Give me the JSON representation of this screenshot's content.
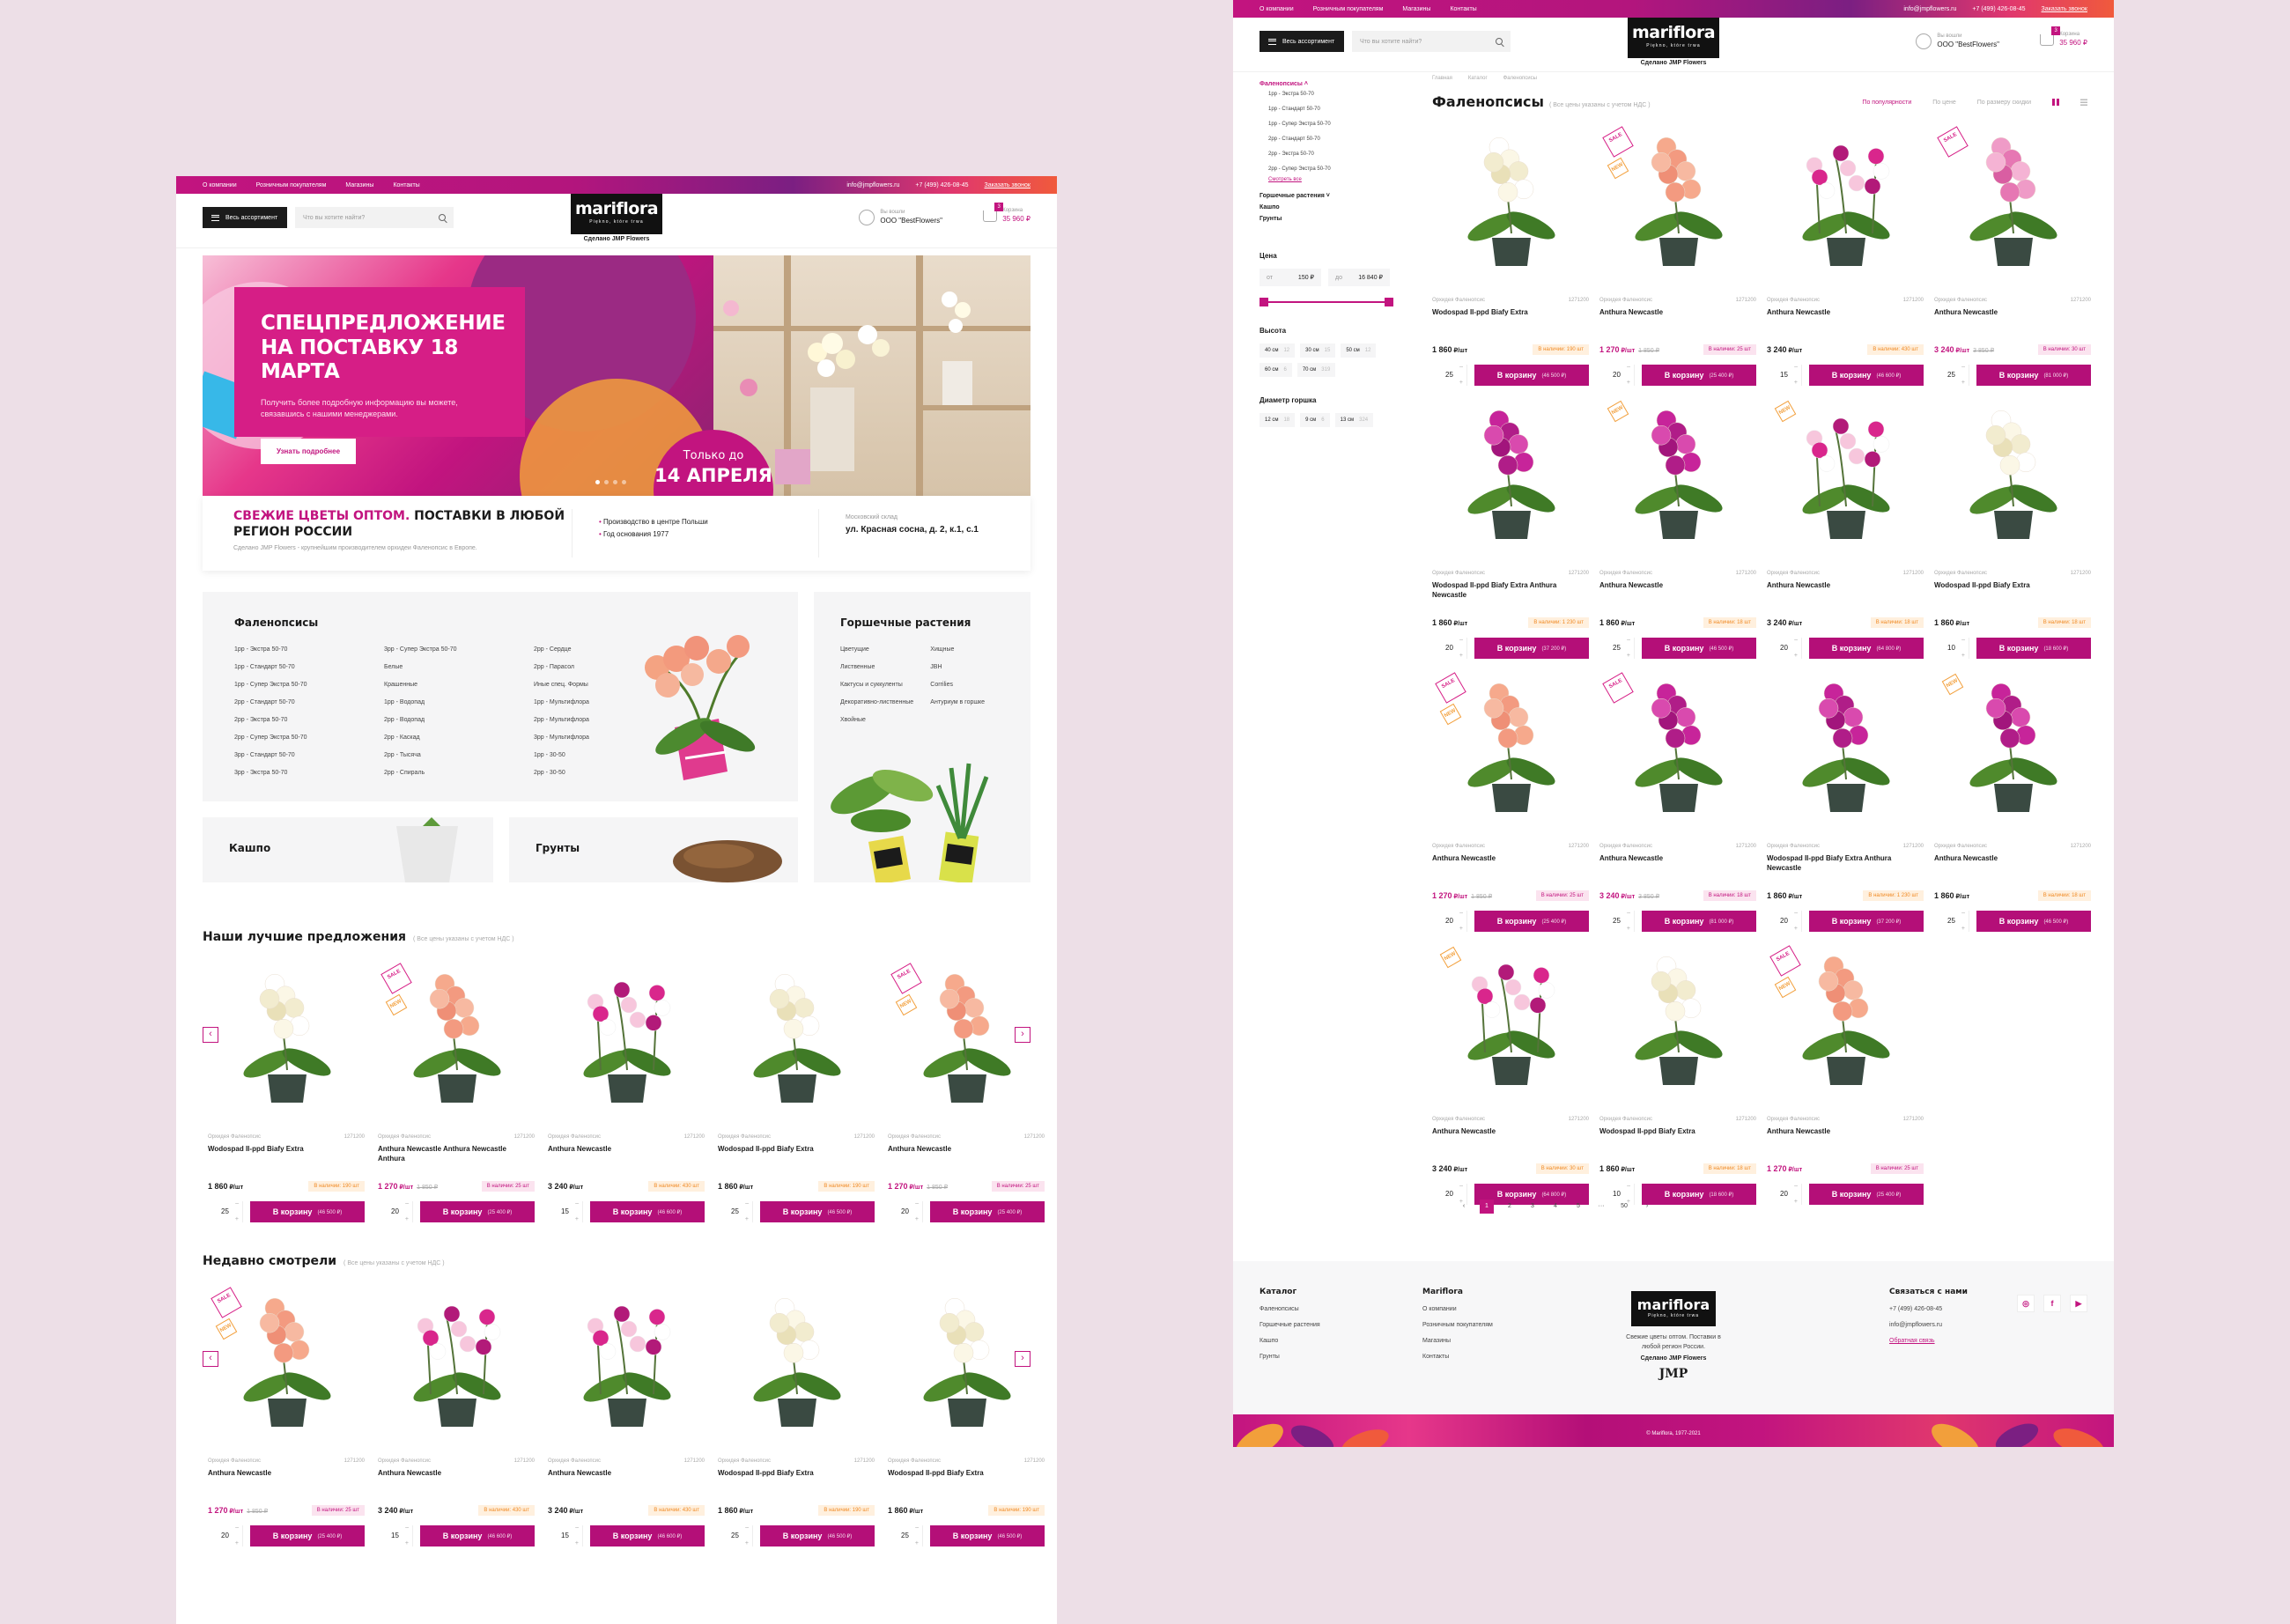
{
  "colors": {
    "brand": "#c2147f",
    "button": "#b40f78",
    "sale_tag": "#d61e86",
    "new_tag": "#f29f3b",
    "canvas": "#eddfe7"
  },
  "header": {
    "nav": [
      "О компании",
      "Розничным покупателям",
      "Магазины",
      "Контакты"
    ],
    "email": "info@jmpflowers.ru",
    "phone": "+7 (499) 426-08-45",
    "callback": "Заказать звонок",
    "menu_label": "Весь ассортимент",
    "search_placeholder": "Что вы хотите найти?",
    "logo_name": "mariflora",
    "logo_slogan": "Piękno, które trwa",
    "byline": "Сделано JMP Flowers",
    "account_caption": "Вы вошли",
    "account_name": "ООО \"BestFlowers\"",
    "cart_caption": "Корзина",
    "cart_count": "3",
    "cart_total": "35 960 ₽"
  },
  "banner": {
    "title": "СПЕЦПРЕДЛОЖЕНИЕ НА ПОСТАВКУ 18 МАРТА",
    "text": "Получить более подробную информацию вы можете, связавшись с нашими менеджерами.",
    "button": "Узнать подробнее",
    "until_top": "Только до",
    "until_date": "14 АПРЕЛЯ"
  },
  "infobar": {
    "title_pink": "СВЕЖИЕ ЦВЕТЫ ОПТОМ.",
    "title_dark": "ПОСТАВКИ В ЛЮБОЙ РЕГИОН РОССИИ",
    "subtitle": "Сделано JMP Flowers - крупнейшим производителем орхидеи Фаленопсис в Европе.",
    "bullets": [
      "Производство в центре Польши",
      "Год основания 1977"
    ],
    "warehouse_caption": "Московский склад",
    "warehouse_address": "ул. Красная сосна, д. 2, к.1, с.1"
  },
  "catalog": {
    "phal_title": "Фаленопсисы",
    "phal_col1": [
      "1рр - Экстра 50-70",
      "1рр - Стандарт 50-70",
      "1рр - Супер Экстра 50-70",
      "2рр - Стандарт 50-70",
      "2рр - Экстра 50-70",
      "2рр - Супер Экстра 50-70",
      "3рр - Стандарт 50-70",
      "3рр - Экстра 50-70"
    ],
    "phal_col2": [
      "3рр - Супер Экстра 50-70",
      "Белые",
      "Крашенные",
      "1рр - Водопад",
      "2рр - Водопад",
      "2рр - Каскад",
      "2рр - Тысяча",
      "2рр - Спираль"
    ],
    "phal_col3": [
      "2рр - Сердце",
      "2рр - Парасол",
      "Иные спец. Формы",
      "1рр - Мультифлора",
      "2рр - Мультифлора",
      "3рр - Мультифлора",
      "1рр - 30-50",
      "2рр - 30-50"
    ],
    "pot_title": "Горшечные растения",
    "pot_col1": [
      "Цветущие",
      "Лиственные",
      "Кактусы и суккуленты",
      "Декоративно-лиственные",
      "Хвойные"
    ],
    "pot_col2": [
      "Хищные",
      "JBH",
      "Corrilies",
      "Антуриум в горшке"
    ],
    "kashpo": "Кашпо",
    "grunty": "Грунты"
  },
  "best": {
    "title": "Наши лучшие предложения",
    "note": "( Все цены указаны с учетом НДС )"
  },
  "recent": {
    "title": "Недавно смотрели",
    "note": "( Все цены указаны с учетом НДС )"
  },
  "best_items": [
    {
      "cat": "Орхидея Фаленопсис",
      "sku": "1271200",
      "name": "Wodospad II-ppd Biafy Extra",
      "price": "1 860",
      "old": "",
      "stock": "В наличии: 190 шт",
      "qty": "25",
      "sum": "(46 500 ₽)",
      "sale": false,
      "new": false,
      "flower": "white"
    },
    {
      "cat": "Орхидея Фаленопсис",
      "sku": "1271200",
      "name": "Anthura Newcastle Anthura Newcastle Anthura",
      "price": "1 270",
      "old": "1 850 ₽",
      "stock": "В наличии: 25 шт",
      "qty": "20",
      "sum": "(25 400 ₽)",
      "sale": true,
      "new": true,
      "flower": "peach"
    },
    {
      "cat": "Орхидея Фаленопсис",
      "sku": "1271200",
      "name": "Anthura Newcastle",
      "price": "3 240",
      "old": "",
      "stock": "В наличии: 430 шт",
      "qty": "15",
      "sum": "(46 600 ₽)",
      "sale": false,
      "new": false,
      "flower": "mix"
    },
    {
      "cat": "Орхидея Фаленопсис",
      "sku": "1271200",
      "name": "Wodospad II-ppd Biafy Extra",
      "price": "1 860",
      "old": "",
      "stock": "В наличии: 190 шт",
      "qty": "25",
      "sum": "(46 500 ₽)",
      "sale": false,
      "new": false,
      "flower": "white"
    },
    {
      "cat": "Орхидея Фаленопсис",
      "sku": "1271200",
      "name": "Anthura Newcastle",
      "price": "1 270",
      "old": "1 850 ₽",
      "stock": "В наличии: 25 шт",
      "qty": "20",
      "sum": "(25 400 ₽)",
      "sale": true,
      "new": true,
      "flower": "peach"
    }
  ],
  "recent_items": [
    {
      "cat": "Орхидея Фаленопсис",
      "sku": "1271200",
      "name": "Anthura Newcastle",
      "price": "1 270",
      "old": "1 850 ₽",
      "stock": "В наличии: 25 шт",
      "qty": "20",
      "sum": "(25 400 ₽)",
      "sale": true,
      "new": true,
      "flower": "peach"
    },
    {
      "cat": "Орхидея Фаленопсис",
      "sku": "1271200",
      "name": "Anthura Newcastle",
      "price": "3 240",
      "old": "",
      "stock": "В наличии: 430 шт",
      "qty": "15",
      "sum": "(46 600 ₽)",
      "sale": false,
      "new": false,
      "flower": "mix"
    },
    {
      "cat": "Орхидея Фаленопсис",
      "sku": "1271200",
      "name": "Anthura Newcastle",
      "price": "3 240",
      "old": "",
      "stock": "В наличии: 430 шт",
      "qty": "15",
      "sum": "(46 600 ₽)",
      "sale": false,
      "new": false,
      "flower": "mix"
    },
    {
      "cat": "Орхидея Фаленопсис",
      "sku": "1271200",
      "name": "Wodospad II-ppd Biafy Extra",
      "price": "1 860",
      "old": "",
      "stock": "В наличии: 190 шт",
      "qty": "25",
      "sum": "(46 500 ₽)",
      "sale": false,
      "new": false,
      "flower": "white"
    },
    {
      "cat": "Орхидея Фаленопсис",
      "sku": "1271200",
      "name": "Wodospad II-ppd Biafy Extra",
      "price": "1 860",
      "old": "",
      "stock": "В наличии: 190 шт",
      "qty": "25",
      "sum": "(46 500 ₽)",
      "sale": false,
      "new": false,
      "flower": "white"
    }
  ],
  "catalog_page": {
    "sidebar_title": "Фаленопсисы",
    "sidebar_items": [
      "1рр - Экстра 50-70",
      "1рр - Стандарт 50-70",
      "1рр - Супер Экстра 50-70",
      "2рр - Стандарт 50-70",
      "2рр - Экстра 50-70",
      "2рр - Супер Экстра 50-70"
    ],
    "show_all": "Смотреть все",
    "other_groups": [
      "Горшечные растения",
      "Кашпо",
      "Грунты"
    ],
    "price_label": "Цена",
    "price_from_label": "от",
    "price_from": "150 ₽",
    "price_to_label": "до",
    "price_to": "16 840 ₽",
    "height_label": "Высота",
    "heights": [
      [
        "40 см",
        "12"
      ],
      [
        "30 см",
        "15"
      ],
      [
        "50 см",
        "12"
      ],
      [
        "60 см",
        "6"
      ],
      [
        "70 см",
        "319"
      ]
    ],
    "diam_label": "Диаметр горшка",
    "diams": [
      [
        "12 см",
        "18"
      ],
      [
        "9 см",
        "6"
      ],
      [
        "13 см",
        "324"
      ]
    ],
    "crumbs": [
      "Главная",
      "Каталог",
      "Фаленопсисы"
    ],
    "title": "Фаленопсисы",
    "title_note": "( Все цены указаны с учетом НДС )",
    "sort": [
      "По популярности",
      "По цене",
      "По размеру скидки"
    ],
    "pages": [
      "‹",
      "1",
      "2",
      "3",
      "4",
      "5",
      "···",
      "50",
      "›"
    ]
  },
  "grid_items": [
    {
      "cat": "Орхидея Фаленопсис",
      "sku": "1271200",
      "name": "Wodospad II-ppd Biafy Extra",
      "price": "1 860",
      "old": "",
      "stock": "В наличии: 190 шт",
      "qty": "25",
      "sum": "(46 500 ₽)",
      "sale": false,
      "new": false,
      "flower": "white"
    },
    {
      "cat": "Орхидея Фаленопсис",
      "sku": "1271200",
      "name": "Anthura Newcastle",
      "price": "1 270",
      "old": "1 850 ₽",
      "stock": "В наличии: 25 шт",
      "qty": "20",
      "sum": "(25 400 ₽)",
      "sale": true,
      "new": true,
      "flower": "peach"
    },
    {
      "cat": "Орхидея Фаленопсис",
      "sku": "1271200",
      "name": "Anthura Newcastle",
      "price": "3 240",
      "old": "",
      "stock": "В наличии: 430 шт",
      "qty": "15",
      "sum": "(46 600 ₽)",
      "sale": false,
      "new": false,
      "flower": "mix"
    },
    {
      "cat": "Орхидея Фаленопсис",
      "sku": "1271200",
      "name": "Anthura Newcastle",
      "price": "3 240",
      "old": "3 850 ₽",
      "stock": "В наличии: 30 шт",
      "qty": "25",
      "sum": "(81 000 ₽)",
      "sale": true,
      "new": false,
      "flower": "pink"
    },
    {
      "cat": "Орхидея Фаленопсис",
      "sku": "1271200",
      "name": "Wodospad II-ppd Biafy Extra Anthura Newcastle",
      "price": "1 860",
      "old": "",
      "stock": "В наличии: 1 230 шт",
      "qty": "20",
      "sum": "(37 200 ₽)",
      "sale": false,
      "new": false,
      "flower": "magenta"
    },
    {
      "cat": "Орхидея Фаленопсис",
      "sku": "1271200",
      "name": "Anthura Newcastle",
      "price": "1 860",
      "old": "",
      "stock": "В наличии: 18 шт",
      "qty": "25",
      "sum": "(46 500 ₽)",
      "sale": false,
      "new": true,
      "flower": "magenta"
    },
    {
      "cat": "Орхидея Фаленопсис",
      "sku": "1271200",
      "name": "Anthura Newcastle",
      "price": "3 240",
      "old": "",
      "stock": "В наличии: 18 шт",
      "qty": "20",
      "sum": "(64 800 ₽)",
      "sale": false,
      "new": true,
      "flower": "mix"
    },
    {
      "cat": "Орхидея Фаленопсис",
      "sku": "1271200",
      "name": "Wodospad II-ppd Biafy Extra",
      "price": "1 860",
      "old": "",
      "stock": "В наличии: 18 шт",
      "qty": "10",
      "sum": "(18 600 ₽)",
      "sale": false,
      "new": false,
      "flower": "white"
    },
    {
      "cat": "Орхидея Фаленопсис",
      "sku": "1271200",
      "name": "Anthura Newcastle",
      "price": "1 270",
      "old": "1 850 ₽",
      "stock": "В наличии: 25 шт",
      "qty": "20",
      "sum": "(25 400 ₽)",
      "sale": true,
      "new": true,
      "flower": "peach"
    },
    {
      "cat": "Орхидея Фаленопсис",
      "sku": "1271200",
      "name": "Anthura Newcastle",
      "price": "3 240",
      "old": "3 850 ₽",
      "stock": "В наличии: 18 шт",
      "qty": "25",
      "sum": "(81 000 ₽)",
      "sale": true,
      "new": false,
      "flower": "magenta"
    },
    {
      "cat": "Орхидея Фаленопсис",
      "sku": "1271200",
      "name": "Wodospad II-ppd Biafy Extra Anthura Newcastle",
      "price": "1 860",
      "old": "",
      "stock": "В наличии: 1 230 шт",
      "qty": "20",
      "sum": "(37 200 ₽)",
      "sale": false,
      "new": false,
      "flower": "magenta"
    },
    {
      "cat": "Орхидея Фаленопсис",
      "sku": "1271200",
      "name": "Anthura Newcastle",
      "price": "1 860",
      "old": "",
      "stock": "В наличии: 18 шт",
      "qty": "25",
      "sum": "(46 500 ₽)",
      "sale": false,
      "new": true,
      "flower": "magenta"
    },
    {
      "cat": "Орхидея Фаленопсис",
      "sku": "1271200",
      "name": "Anthura Newcastle",
      "price": "3 240",
      "old": "",
      "stock": "В наличии: 30 шт",
      "qty": "20",
      "sum": "(64 800 ₽)",
      "sale": false,
      "new": true,
      "flower": "mix"
    },
    {
      "cat": "Орхидея Фаленопсис",
      "sku": "1271200",
      "name": "Wodospad II-ppd Biafy Extra",
      "price": "1 860",
      "old": "",
      "stock": "В наличии: 18 шт",
      "qty": "10",
      "sum": "(18 600 ₽)",
      "sale": false,
      "new": false,
      "flower": "white"
    },
    {
      "cat": "Орхидея Фаленопсис",
      "sku": "1271200",
      "name": "Anthura Newcastle",
      "price": "1 270",
      "old": "",
      "stock": "В наличии: 25 шт",
      "qty": "20",
      "sum": "(25 400 ₽)",
      "sale": true,
      "new": true,
      "flower": "peach"
    }
  ],
  "footer": {
    "catalog_title": "Каталог",
    "catalog_links": [
      "Фаленопсисы",
      "Горшечные растения",
      "Кашпо",
      "Грунты"
    ],
    "brand_title": "Mariflora",
    "brand_links": [
      "О компании",
      "Розничным покупателям",
      "Магазины",
      "Контакты"
    ],
    "about": "Свежие цветы оптом. Поставки в любой регион России.",
    "byline": "Сделано JMP Flowers",
    "jmp_logo": "JMP",
    "contact_title": "Связаться с нами",
    "phone": "+7 (499) 426-08-45",
    "email": "info@jmpflowers.ru",
    "callback": "Обратная связь",
    "social": [
      "instagram-icon",
      "facebook-icon",
      "youtube-icon"
    ],
    "copyright": "© Mariflora, 1977-2021"
  }
}
